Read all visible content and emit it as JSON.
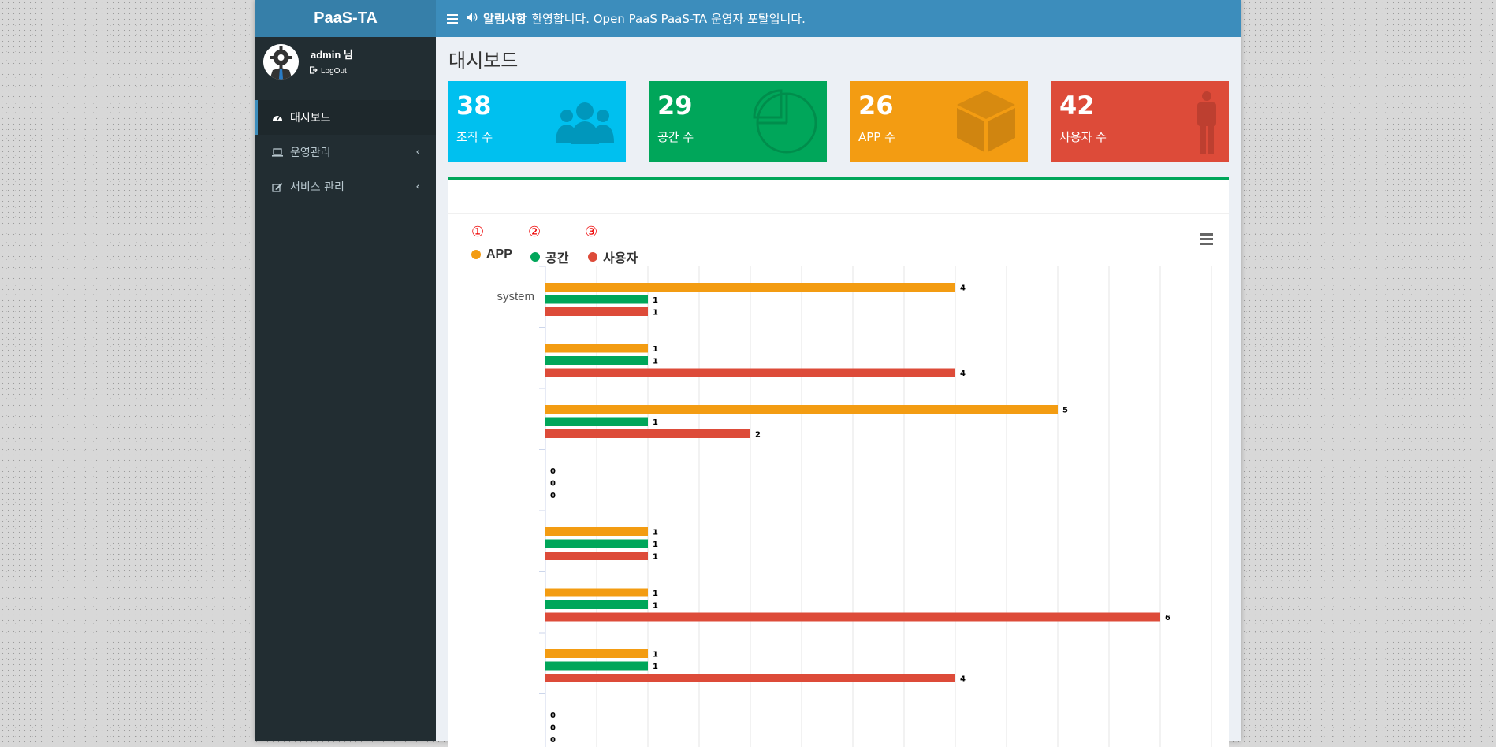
{
  "sidebar": {
    "brand": "PaaS-TA",
    "user": "admin 님",
    "logout": "LogOut",
    "items": [
      {
        "label": "대시보드",
        "icon": "dashboard-icon"
      },
      {
        "label": "운영관리",
        "icon": "laptop-icon"
      },
      {
        "label": "서비스 관리",
        "icon": "edit-icon"
      }
    ]
  },
  "topbar": {
    "notice_title": "알림사항",
    "notice_text": "환영합니다. Open PaaS PaaS-TA 운영자 포탈입니다."
  },
  "page_title": "대시보드",
  "stats": [
    {
      "value": "38",
      "label": "조직 수",
      "color": "#00c0ef",
      "icon": "users-icon"
    },
    {
      "value": "29",
      "label": "공간 수",
      "color": "#00a65a",
      "icon": "pie-chart-icon"
    },
    {
      "value": "26",
      "label": "APP 수",
      "color": "#f39c12",
      "icon": "cube-icon"
    },
    {
      "value": "42",
      "label": "사용자 수",
      "color": "#dd4b39",
      "icon": "person-icon"
    }
  ],
  "annotations": [
    "①",
    "②",
    "③"
  ],
  "chart_data": {
    "type": "bar",
    "orientation": "horizontal",
    "categories": [
      "system",
      "",
      "",
      "",
      "",
      "",
      "",
      ""
    ],
    "series": [
      {
        "name": "APP",
        "color": "#f39c12",
        "values": [
          4,
          1,
          5,
          0,
          1,
          1,
          1,
          0
        ]
      },
      {
        "name": "공간",
        "color": "#00a65a",
        "values": [
          1,
          1,
          1,
          0,
          1,
          1,
          1,
          0
        ]
      },
      {
        "name": "사용자",
        "color": "#dd4b39",
        "values": [
          1,
          4,
          2,
          0,
          1,
          6,
          4,
          0
        ]
      }
    ],
    "xlim": [
      0,
      6.5
    ],
    "grid": true,
    "legend": "top-left"
  }
}
